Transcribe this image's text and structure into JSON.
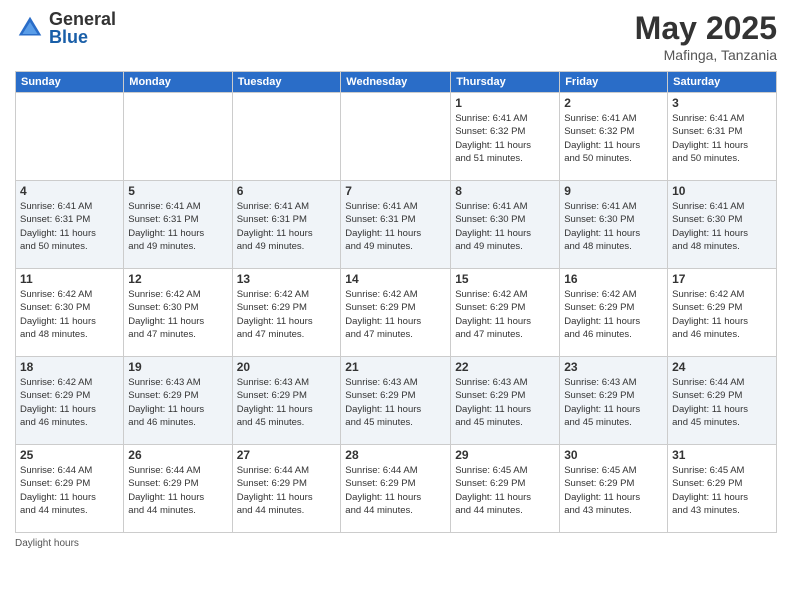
{
  "logo": {
    "general": "General",
    "blue": "Blue"
  },
  "title": {
    "month": "May 2025",
    "location": "Mafinga, Tanzania"
  },
  "days_of_week": [
    "Sunday",
    "Monday",
    "Tuesday",
    "Wednesday",
    "Thursday",
    "Friday",
    "Saturday"
  ],
  "footer": {
    "daylight_label": "Daylight hours"
  },
  "weeks": [
    {
      "days": [
        {
          "num": "",
          "info": ""
        },
        {
          "num": "",
          "info": ""
        },
        {
          "num": "",
          "info": ""
        },
        {
          "num": "",
          "info": ""
        },
        {
          "num": "1",
          "info": "Sunrise: 6:41 AM\nSunset: 6:32 PM\nDaylight: 11 hours\nand 51 minutes."
        },
        {
          "num": "2",
          "info": "Sunrise: 6:41 AM\nSunset: 6:32 PM\nDaylight: 11 hours\nand 50 minutes."
        },
        {
          "num": "3",
          "info": "Sunrise: 6:41 AM\nSunset: 6:31 PM\nDaylight: 11 hours\nand 50 minutes."
        }
      ]
    },
    {
      "days": [
        {
          "num": "4",
          "info": "Sunrise: 6:41 AM\nSunset: 6:31 PM\nDaylight: 11 hours\nand 50 minutes."
        },
        {
          "num": "5",
          "info": "Sunrise: 6:41 AM\nSunset: 6:31 PM\nDaylight: 11 hours\nand 49 minutes."
        },
        {
          "num": "6",
          "info": "Sunrise: 6:41 AM\nSunset: 6:31 PM\nDaylight: 11 hours\nand 49 minutes."
        },
        {
          "num": "7",
          "info": "Sunrise: 6:41 AM\nSunset: 6:31 PM\nDaylight: 11 hours\nand 49 minutes."
        },
        {
          "num": "8",
          "info": "Sunrise: 6:41 AM\nSunset: 6:30 PM\nDaylight: 11 hours\nand 49 minutes."
        },
        {
          "num": "9",
          "info": "Sunrise: 6:41 AM\nSunset: 6:30 PM\nDaylight: 11 hours\nand 48 minutes."
        },
        {
          "num": "10",
          "info": "Sunrise: 6:41 AM\nSunset: 6:30 PM\nDaylight: 11 hours\nand 48 minutes."
        }
      ]
    },
    {
      "days": [
        {
          "num": "11",
          "info": "Sunrise: 6:42 AM\nSunset: 6:30 PM\nDaylight: 11 hours\nand 48 minutes."
        },
        {
          "num": "12",
          "info": "Sunrise: 6:42 AM\nSunset: 6:30 PM\nDaylight: 11 hours\nand 47 minutes."
        },
        {
          "num": "13",
          "info": "Sunrise: 6:42 AM\nSunset: 6:29 PM\nDaylight: 11 hours\nand 47 minutes."
        },
        {
          "num": "14",
          "info": "Sunrise: 6:42 AM\nSunset: 6:29 PM\nDaylight: 11 hours\nand 47 minutes."
        },
        {
          "num": "15",
          "info": "Sunrise: 6:42 AM\nSunset: 6:29 PM\nDaylight: 11 hours\nand 47 minutes."
        },
        {
          "num": "16",
          "info": "Sunrise: 6:42 AM\nSunset: 6:29 PM\nDaylight: 11 hours\nand 46 minutes."
        },
        {
          "num": "17",
          "info": "Sunrise: 6:42 AM\nSunset: 6:29 PM\nDaylight: 11 hours\nand 46 minutes."
        }
      ]
    },
    {
      "days": [
        {
          "num": "18",
          "info": "Sunrise: 6:42 AM\nSunset: 6:29 PM\nDaylight: 11 hours\nand 46 minutes."
        },
        {
          "num": "19",
          "info": "Sunrise: 6:43 AM\nSunset: 6:29 PM\nDaylight: 11 hours\nand 46 minutes."
        },
        {
          "num": "20",
          "info": "Sunrise: 6:43 AM\nSunset: 6:29 PM\nDaylight: 11 hours\nand 45 minutes."
        },
        {
          "num": "21",
          "info": "Sunrise: 6:43 AM\nSunset: 6:29 PM\nDaylight: 11 hours\nand 45 minutes."
        },
        {
          "num": "22",
          "info": "Sunrise: 6:43 AM\nSunset: 6:29 PM\nDaylight: 11 hours\nand 45 minutes."
        },
        {
          "num": "23",
          "info": "Sunrise: 6:43 AM\nSunset: 6:29 PM\nDaylight: 11 hours\nand 45 minutes."
        },
        {
          "num": "24",
          "info": "Sunrise: 6:44 AM\nSunset: 6:29 PM\nDaylight: 11 hours\nand 45 minutes."
        }
      ]
    },
    {
      "days": [
        {
          "num": "25",
          "info": "Sunrise: 6:44 AM\nSunset: 6:29 PM\nDaylight: 11 hours\nand 44 minutes."
        },
        {
          "num": "26",
          "info": "Sunrise: 6:44 AM\nSunset: 6:29 PM\nDaylight: 11 hours\nand 44 minutes."
        },
        {
          "num": "27",
          "info": "Sunrise: 6:44 AM\nSunset: 6:29 PM\nDaylight: 11 hours\nand 44 minutes."
        },
        {
          "num": "28",
          "info": "Sunrise: 6:44 AM\nSunset: 6:29 PM\nDaylight: 11 hours\nand 44 minutes."
        },
        {
          "num": "29",
          "info": "Sunrise: 6:45 AM\nSunset: 6:29 PM\nDaylight: 11 hours\nand 44 minutes."
        },
        {
          "num": "30",
          "info": "Sunrise: 6:45 AM\nSunset: 6:29 PM\nDaylight: 11 hours\nand 43 minutes."
        },
        {
          "num": "31",
          "info": "Sunrise: 6:45 AM\nSunset: 6:29 PM\nDaylight: 11 hours\nand 43 minutes."
        }
      ]
    }
  ]
}
